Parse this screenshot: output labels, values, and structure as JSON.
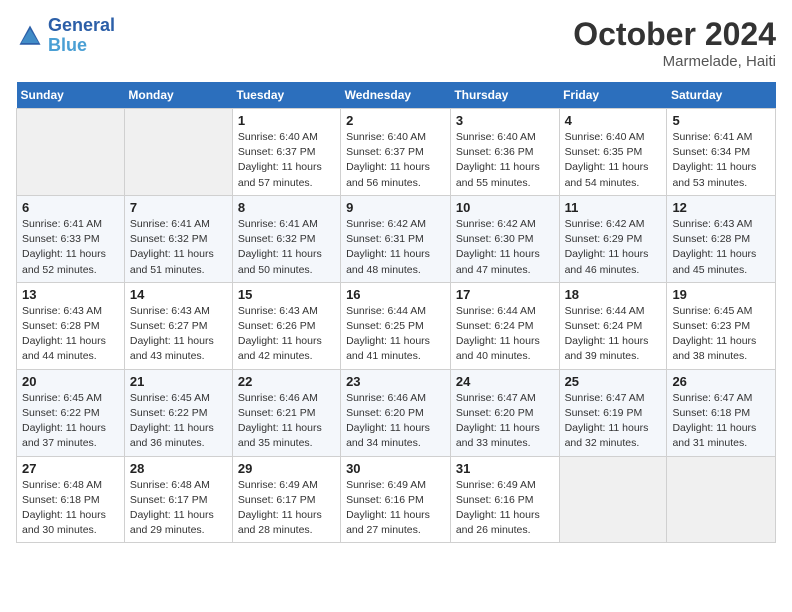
{
  "header": {
    "logo_line1": "General",
    "logo_line2": "Blue",
    "month": "October 2024",
    "location": "Marmelade, Haiti"
  },
  "weekdays": [
    "Sunday",
    "Monday",
    "Tuesday",
    "Wednesday",
    "Thursday",
    "Friday",
    "Saturday"
  ],
  "weeks": [
    [
      {
        "day": "",
        "info": ""
      },
      {
        "day": "",
        "info": ""
      },
      {
        "day": "1",
        "info": "Sunrise: 6:40 AM\nSunset: 6:37 PM\nDaylight: 11 hours and 57 minutes."
      },
      {
        "day": "2",
        "info": "Sunrise: 6:40 AM\nSunset: 6:37 PM\nDaylight: 11 hours and 56 minutes."
      },
      {
        "day": "3",
        "info": "Sunrise: 6:40 AM\nSunset: 6:36 PM\nDaylight: 11 hours and 55 minutes."
      },
      {
        "day": "4",
        "info": "Sunrise: 6:40 AM\nSunset: 6:35 PM\nDaylight: 11 hours and 54 minutes."
      },
      {
        "day": "5",
        "info": "Sunrise: 6:41 AM\nSunset: 6:34 PM\nDaylight: 11 hours and 53 minutes."
      }
    ],
    [
      {
        "day": "6",
        "info": "Sunrise: 6:41 AM\nSunset: 6:33 PM\nDaylight: 11 hours and 52 minutes."
      },
      {
        "day": "7",
        "info": "Sunrise: 6:41 AM\nSunset: 6:32 PM\nDaylight: 11 hours and 51 minutes."
      },
      {
        "day": "8",
        "info": "Sunrise: 6:41 AM\nSunset: 6:32 PM\nDaylight: 11 hours and 50 minutes."
      },
      {
        "day": "9",
        "info": "Sunrise: 6:42 AM\nSunset: 6:31 PM\nDaylight: 11 hours and 48 minutes."
      },
      {
        "day": "10",
        "info": "Sunrise: 6:42 AM\nSunset: 6:30 PM\nDaylight: 11 hours and 47 minutes."
      },
      {
        "day": "11",
        "info": "Sunrise: 6:42 AM\nSunset: 6:29 PM\nDaylight: 11 hours and 46 minutes."
      },
      {
        "day": "12",
        "info": "Sunrise: 6:43 AM\nSunset: 6:28 PM\nDaylight: 11 hours and 45 minutes."
      }
    ],
    [
      {
        "day": "13",
        "info": "Sunrise: 6:43 AM\nSunset: 6:28 PM\nDaylight: 11 hours and 44 minutes."
      },
      {
        "day": "14",
        "info": "Sunrise: 6:43 AM\nSunset: 6:27 PM\nDaylight: 11 hours and 43 minutes."
      },
      {
        "day": "15",
        "info": "Sunrise: 6:43 AM\nSunset: 6:26 PM\nDaylight: 11 hours and 42 minutes."
      },
      {
        "day": "16",
        "info": "Sunrise: 6:44 AM\nSunset: 6:25 PM\nDaylight: 11 hours and 41 minutes."
      },
      {
        "day": "17",
        "info": "Sunrise: 6:44 AM\nSunset: 6:24 PM\nDaylight: 11 hours and 40 minutes."
      },
      {
        "day": "18",
        "info": "Sunrise: 6:44 AM\nSunset: 6:24 PM\nDaylight: 11 hours and 39 minutes."
      },
      {
        "day": "19",
        "info": "Sunrise: 6:45 AM\nSunset: 6:23 PM\nDaylight: 11 hours and 38 minutes."
      }
    ],
    [
      {
        "day": "20",
        "info": "Sunrise: 6:45 AM\nSunset: 6:22 PM\nDaylight: 11 hours and 37 minutes."
      },
      {
        "day": "21",
        "info": "Sunrise: 6:45 AM\nSunset: 6:22 PM\nDaylight: 11 hours and 36 minutes."
      },
      {
        "day": "22",
        "info": "Sunrise: 6:46 AM\nSunset: 6:21 PM\nDaylight: 11 hours and 35 minutes."
      },
      {
        "day": "23",
        "info": "Sunrise: 6:46 AM\nSunset: 6:20 PM\nDaylight: 11 hours and 34 minutes."
      },
      {
        "day": "24",
        "info": "Sunrise: 6:47 AM\nSunset: 6:20 PM\nDaylight: 11 hours and 33 minutes."
      },
      {
        "day": "25",
        "info": "Sunrise: 6:47 AM\nSunset: 6:19 PM\nDaylight: 11 hours and 32 minutes."
      },
      {
        "day": "26",
        "info": "Sunrise: 6:47 AM\nSunset: 6:18 PM\nDaylight: 11 hours and 31 minutes."
      }
    ],
    [
      {
        "day": "27",
        "info": "Sunrise: 6:48 AM\nSunset: 6:18 PM\nDaylight: 11 hours and 30 minutes."
      },
      {
        "day": "28",
        "info": "Sunrise: 6:48 AM\nSunset: 6:17 PM\nDaylight: 11 hours and 29 minutes."
      },
      {
        "day": "29",
        "info": "Sunrise: 6:49 AM\nSunset: 6:17 PM\nDaylight: 11 hours and 28 minutes."
      },
      {
        "day": "30",
        "info": "Sunrise: 6:49 AM\nSunset: 6:16 PM\nDaylight: 11 hours and 27 minutes."
      },
      {
        "day": "31",
        "info": "Sunrise: 6:49 AM\nSunset: 6:16 PM\nDaylight: 11 hours and 26 minutes."
      },
      {
        "day": "",
        "info": ""
      },
      {
        "day": "",
        "info": ""
      }
    ]
  ]
}
